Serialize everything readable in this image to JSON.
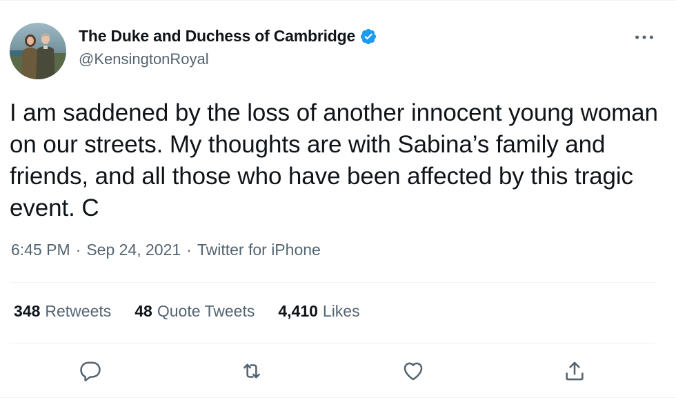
{
  "author": {
    "name": "The Duke and Duchess of Cambridge",
    "handle": "@KensingtonRoyal",
    "verified": true,
    "verified_color": "#1d9bf0",
    "avatar_icon": "profile-photo-couple"
  },
  "tweet": {
    "text": "I am saddened by the loss of another innocent young woman on our streets. My thoughts are with Sabina’s family and friends, and all those who have been affected by this tragic event. C"
  },
  "meta": {
    "time": "6:45 PM",
    "separator": "·",
    "date": "Sep 24, 2021",
    "source": "Twitter for iPhone"
  },
  "stats": {
    "retweets": {
      "count": "348",
      "label": "Retweets"
    },
    "quotes": {
      "count": "48",
      "label": "Quote Tweets"
    },
    "likes": {
      "count": "4,410",
      "label": "Likes"
    }
  },
  "actions": [
    {
      "icon": "reply-icon"
    },
    {
      "icon": "retweet-icon"
    },
    {
      "icon": "like-icon"
    },
    {
      "icon": "share-icon"
    }
  ],
  "colors": {
    "text_primary": "#0f1419",
    "text_secondary": "#536471",
    "divider": "#eff3f4"
  }
}
